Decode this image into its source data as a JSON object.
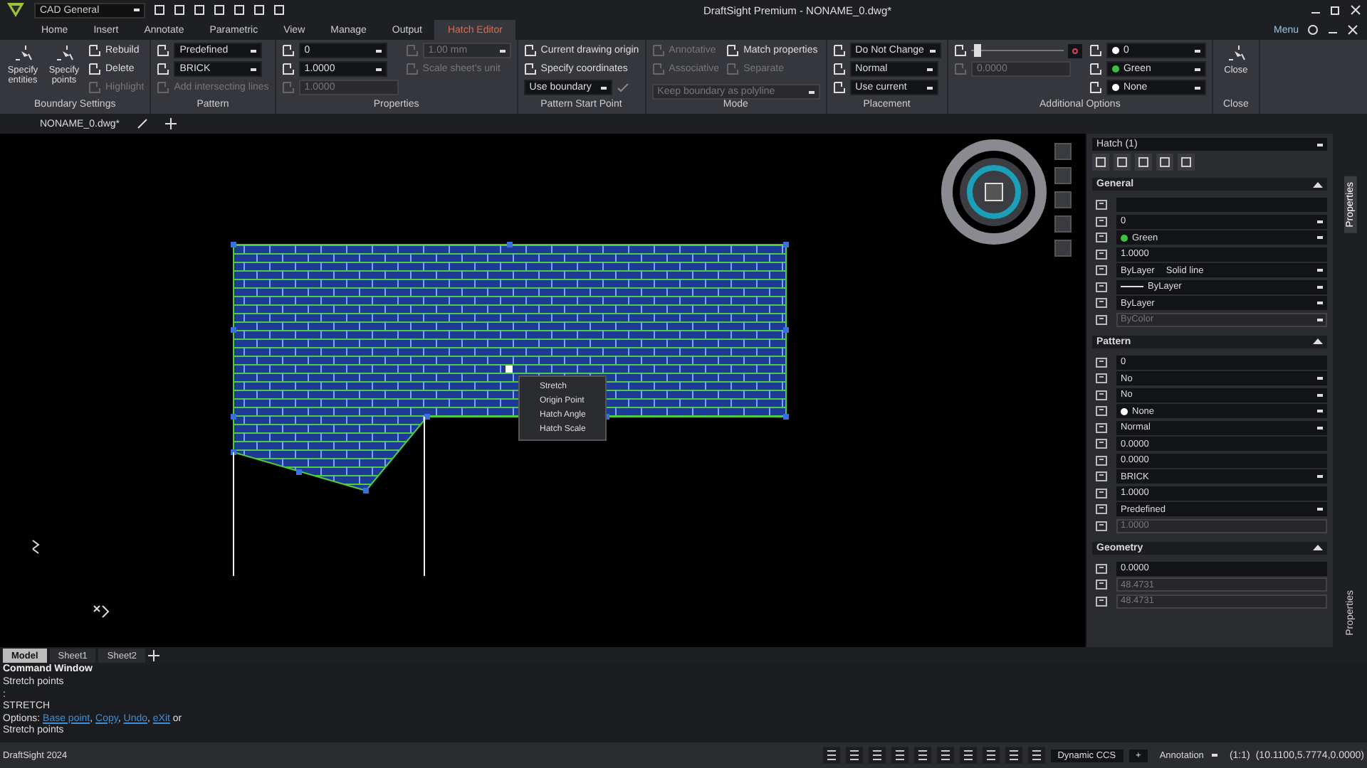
{
  "app": {
    "workspace": "CAD General",
    "title": "DraftSight Premium - NONAME_0.dwg*",
    "menu": "Menu"
  },
  "ribbon_tabs": [
    {
      "label": "Home",
      "selected": false
    },
    {
      "label": "Insert",
      "selected": false
    },
    {
      "label": "Annotate",
      "selected": false
    },
    {
      "label": "Parametric",
      "selected": false
    },
    {
      "label": "View",
      "selected": false
    },
    {
      "label": "Manage",
      "selected": false
    },
    {
      "label": "Output",
      "selected": false
    },
    {
      "label": "Hatch Editor",
      "selected": true
    }
  ],
  "ribbon_groups": [
    {
      "title": "Boundary Settings",
      "columns": [
        [
          {
            "kind": "big_button",
            "label": "Specify entities",
            "disabled": false
          }
        ],
        [
          {
            "kind": "big_button",
            "label": "Specify points",
            "disabled": false
          }
        ],
        [
          {
            "kind": "button",
            "label": "Rebuild",
            "disabled": false
          },
          {
            "kind": "button",
            "label": "Delete",
            "disabled": false
          },
          {
            "kind": "button",
            "label": "Highlight",
            "disabled": true
          }
        ]
      ]
    },
    {
      "title": "Pattern",
      "columns": [
        [
          {
            "kind": "icon_dropdown",
            "value": "Predefined",
            "disabled": false
          },
          {
            "kind": "icon_dropdown",
            "value": "BRICK",
            "disabled": false
          },
          {
            "kind": "button",
            "label": "Add intersecting lines",
            "disabled": true
          }
        ]
      ]
    },
    {
      "title": "Properties",
      "columns": [
        [
          {
            "kind": "icon_dropdown",
            "value": "0",
            "disabled": false
          },
          {
            "kind": "icon_dropdown",
            "value": "1.0000",
            "disabled": false
          },
          {
            "kind": "icon_field",
            "value": "1.0000",
            "disabled": true
          }
        ],
        [
          {
            "kind": "icon_dropdown",
            "value": "1.00 mm",
            "disabled": true
          },
          {
            "kind": "button",
            "label": "Scale sheet's unit",
            "disabled": true
          }
        ]
      ]
    },
    {
      "title": "Pattern Start Point",
      "columns": [
        [
          {
            "kind": "button",
            "label": "Current drawing origin",
            "disabled": false
          },
          {
            "kind": "button",
            "label": "Specify coordinates",
            "disabled": false
          },
          {
            "kind": "dropdown_apply",
            "value": "Use boundary",
            "disabled": false
          }
        ]
      ]
    },
    {
      "title": "Mode",
      "columns": [
        [
          {
            "kind": "button",
            "label": "Annotative",
            "disabled": true
          },
          {
            "kind": "button",
            "label": "Associative",
            "disabled": true
          }
        ],
        [
          {
            "kind": "button",
            "label": "Match properties",
            "disabled": false
          },
          {
            "kind": "button",
            "label": "Separate",
            "disabled": true
          }
        ]
      ],
      "footer": [
        {
          "kind": "dropdown",
          "value": "Keep boundary as polyline",
          "disabled": true
        }
      ]
    },
    {
      "title": "Placement",
      "columns": [
        [
          {
            "kind": "icon_dropdown",
            "value": "Do Not Change",
            "disabled": false
          },
          {
            "kind": "icon_dropdown",
            "value": "Normal",
            "disabled": false
          },
          {
            "kind": "icon_dropdown",
            "value": "Use current",
            "disabled": false
          }
        ]
      ]
    },
    {
      "title": "Additional Options",
      "columns": [
        [
          {
            "kind": "slider",
            "level": 0.06
          },
          {
            "kind": "icon_field",
            "value": "0.0000",
            "disabled": true
          }
        ],
        [
          {
            "kind": "color_dropdown",
            "value": "0",
            "color": "#ffffff",
            "disabled": false
          },
          {
            "kind": "color_dropdown",
            "value": "Green",
            "color": "#3fbf3f",
            "disabled": false
          },
          {
            "kind": "color_dropdown",
            "value": "None",
            "color": "#ffffff",
            "disabled": false
          }
        ]
      ]
    },
    {
      "title": "Close",
      "columns": [
        [
          {
            "kind": "big_button",
            "label": "Close",
            "disabled": false
          }
        ]
      ]
    }
  ],
  "document_tab": {
    "label": "NONAME_0.dwg*"
  },
  "context_menu": [
    "Stretch",
    "Origin Point",
    "Hatch Angle",
    "Hatch Scale"
  ],
  "properties_panel": {
    "selector": "Hatch (1)",
    "sections": [
      {
        "title": "General",
        "rows": [
          {
            "kind": "field",
            "disabled": false
          },
          {
            "kind": "dropdown",
            "value": "0",
            "disabled": false
          },
          {
            "kind": "color",
            "value": "Green",
            "color": "#3fbf3f",
            "disabled": false
          },
          {
            "kind": "field",
            "value": "1.0000",
            "disabled": false
          },
          {
            "kind": "dropdown",
            "value": "ByLayer",
            "extra": "Solid line",
            "disabled": false
          },
          {
            "kind": "linetype",
            "value": "ByLayer",
            "disabled": false
          },
          {
            "kind": "dropdown",
            "value": "ByLayer",
            "disabled": false
          },
          {
            "kind": "dropdown",
            "value": "ByColor",
            "disabled": true
          }
        ]
      },
      {
        "title": "Pattern",
        "rows": [
          {
            "kind": "field",
            "value": "0",
            "disabled": false
          },
          {
            "kind": "dropdown",
            "value": "No",
            "disabled": false
          },
          {
            "kind": "dropdown",
            "value": "No",
            "disabled": false
          },
          {
            "kind": "color",
            "value": "None",
            "color": "#ffffff",
            "disabled": false
          },
          {
            "kind": "dropdown",
            "value": "Normal",
            "disabled": false
          },
          {
            "kind": "field",
            "value": "0.0000",
            "disabled": false
          },
          {
            "kind": "field",
            "value": "0.0000",
            "disabled": false
          },
          {
            "kind": "dropdown",
            "value": "BRICK",
            "disabled": false
          },
          {
            "kind": "field",
            "value": "1.0000",
            "disabled": false
          },
          {
            "kind": "dropdown",
            "value": "Predefined",
            "disabled": false
          },
          {
            "kind": "field",
            "value": "1.0000",
            "disabled": true
          }
        ]
      },
      {
        "title": "Geometry",
        "rows": [
          {
            "kind": "field",
            "value": "0.0000",
            "disabled": false
          },
          {
            "kind": "field",
            "value": "48.4731",
            "disabled": true
          },
          {
            "kind": "field",
            "value": "48.4731",
            "disabled": true
          }
        ]
      }
    ]
  },
  "side_tabs": [
    {
      "label": "Properties",
      "selected": true
    }
  ],
  "panel_caption": "Properties",
  "sheet_tabs": [
    {
      "label": "Model",
      "selected": true
    },
    {
      "label": "Sheet1",
      "selected": false
    },
    {
      "label": "Sheet2",
      "selected": false
    }
  ],
  "command_window": {
    "title": "Command Window",
    "lines": [
      "Stretch points",
      ":",
      "STRETCH"
    ],
    "prompt": "Options:",
    "options": [
      {
        "label": "Base point",
        "after": ","
      },
      {
        "label": "Copy",
        "after": ","
      },
      {
        "label": "Undo",
        "after": ","
      },
      {
        "label": "eXit",
        "after": " or"
      }
    ],
    "last_line": "Stretch points"
  },
  "status_bar": {
    "product": "DraftSight 2024",
    "ccs": "Dynamic CCS",
    "plus": "+",
    "annotation": "Annotation",
    "scale": "(1:1)",
    "coordinates": "(10.1100,5.7774,0.0000)"
  }
}
